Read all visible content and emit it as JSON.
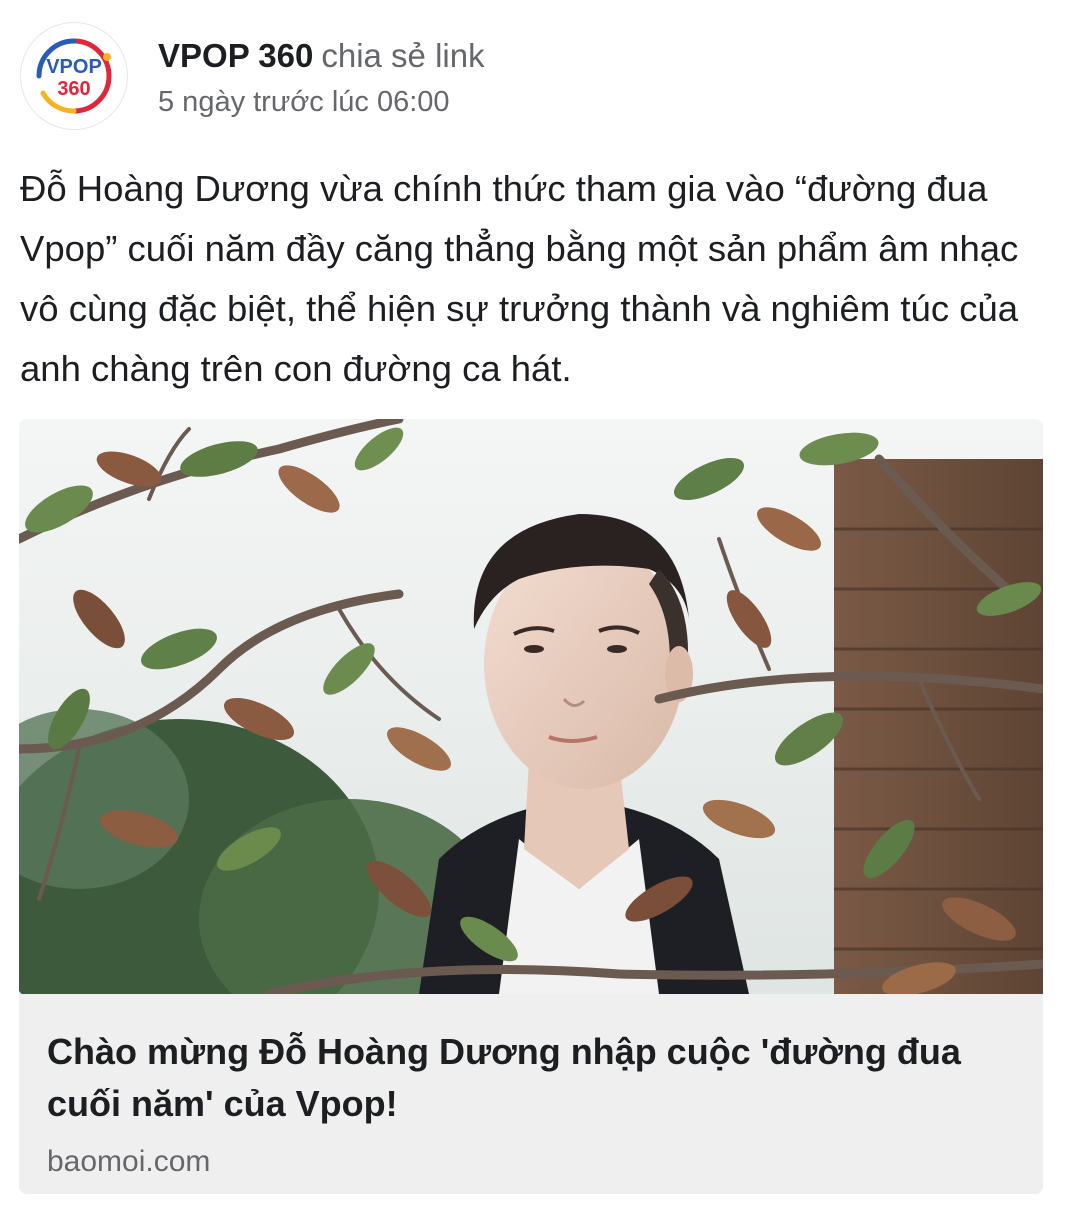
{
  "post": {
    "author": "VPOP 360",
    "action": "chia sẻ link",
    "timestamp": "5 ngày trước lúc 06:00",
    "text": "Đỗ Hoàng Dương vừa chính thức tham gia vào “đường đua Vpop” cuối năm đầy căng thẳng bằng một sản phẩm âm nhạc vô cùng đặc biệt, thể hiện sự trưởng thành và nghiêm túc của anh chàng trên con đường ca hát."
  },
  "avatar": {
    "logo_line1": "VPOP",
    "logo_line2": "360",
    "icon": "vpop360-logo-icon"
  },
  "link": {
    "title": "Chào mừng Đỗ Hoàng Dương nhập cuộc 'đường đua cuối năm' của Vpop!",
    "domain": "baomoi.com",
    "image_icon": "article-photo-image"
  },
  "colors": {
    "logo_blue": "#2a5bb8",
    "logo_red": "#e0273a",
    "logo_yellow": "#f4b323",
    "text_primary": "#1c1e21",
    "text_secondary": "#65676b",
    "card_bg": "#efefef"
  }
}
